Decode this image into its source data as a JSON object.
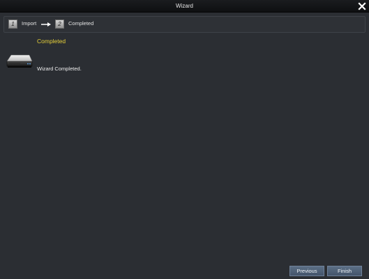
{
  "window": {
    "title": "Wizard"
  },
  "steps": [
    {
      "number": "1",
      "label": "Import"
    },
    {
      "number": "2",
      "label": "Completed"
    }
  ],
  "content": {
    "heading": "Completed",
    "message": "Wizard Completed."
  },
  "buttons": {
    "previous": "Previous",
    "finish": "Finish"
  },
  "colors": {
    "heading": "#e5cf3a",
    "background": "#2b2e33",
    "button": "#4f6178"
  },
  "icons": {
    "close": "close-icon",
    "arrow": "arrow-right-icon",
    "device": "hard-drive-icon"
  }
}
